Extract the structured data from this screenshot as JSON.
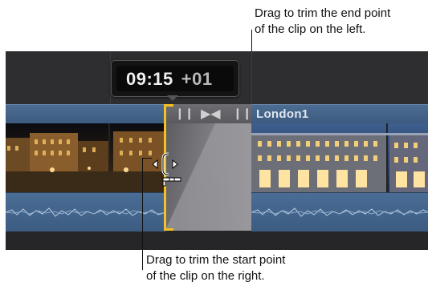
{
  "callouts": {
    "end_point": [
      "Drag to trim the end point",
      "of the clip on the left."
    ],
    "start_point": [
      "Drag to trim the start point",
      "of the clip on the right."
    ]
  },
  "timecode": {
    "time": "09:15",
    "offset": "+01"
  },
  "clips": {
    "right_clip_name": "London1"
  },
  "colors": {
    "trim_edge": "#f4c023",
    "clip_blue": "#4a6d95",
    "timeline_bg": "#2e2e30"
  },
  "icons": {
    "transition_handle_left": "pause-bar-icon",
    "transition_center": "bowtie-transition-icon",
    "transition_handle_right": "pause-bar-icon",
    "trim_cursor": "ripple-trim-cursor-icon"
  }
}
